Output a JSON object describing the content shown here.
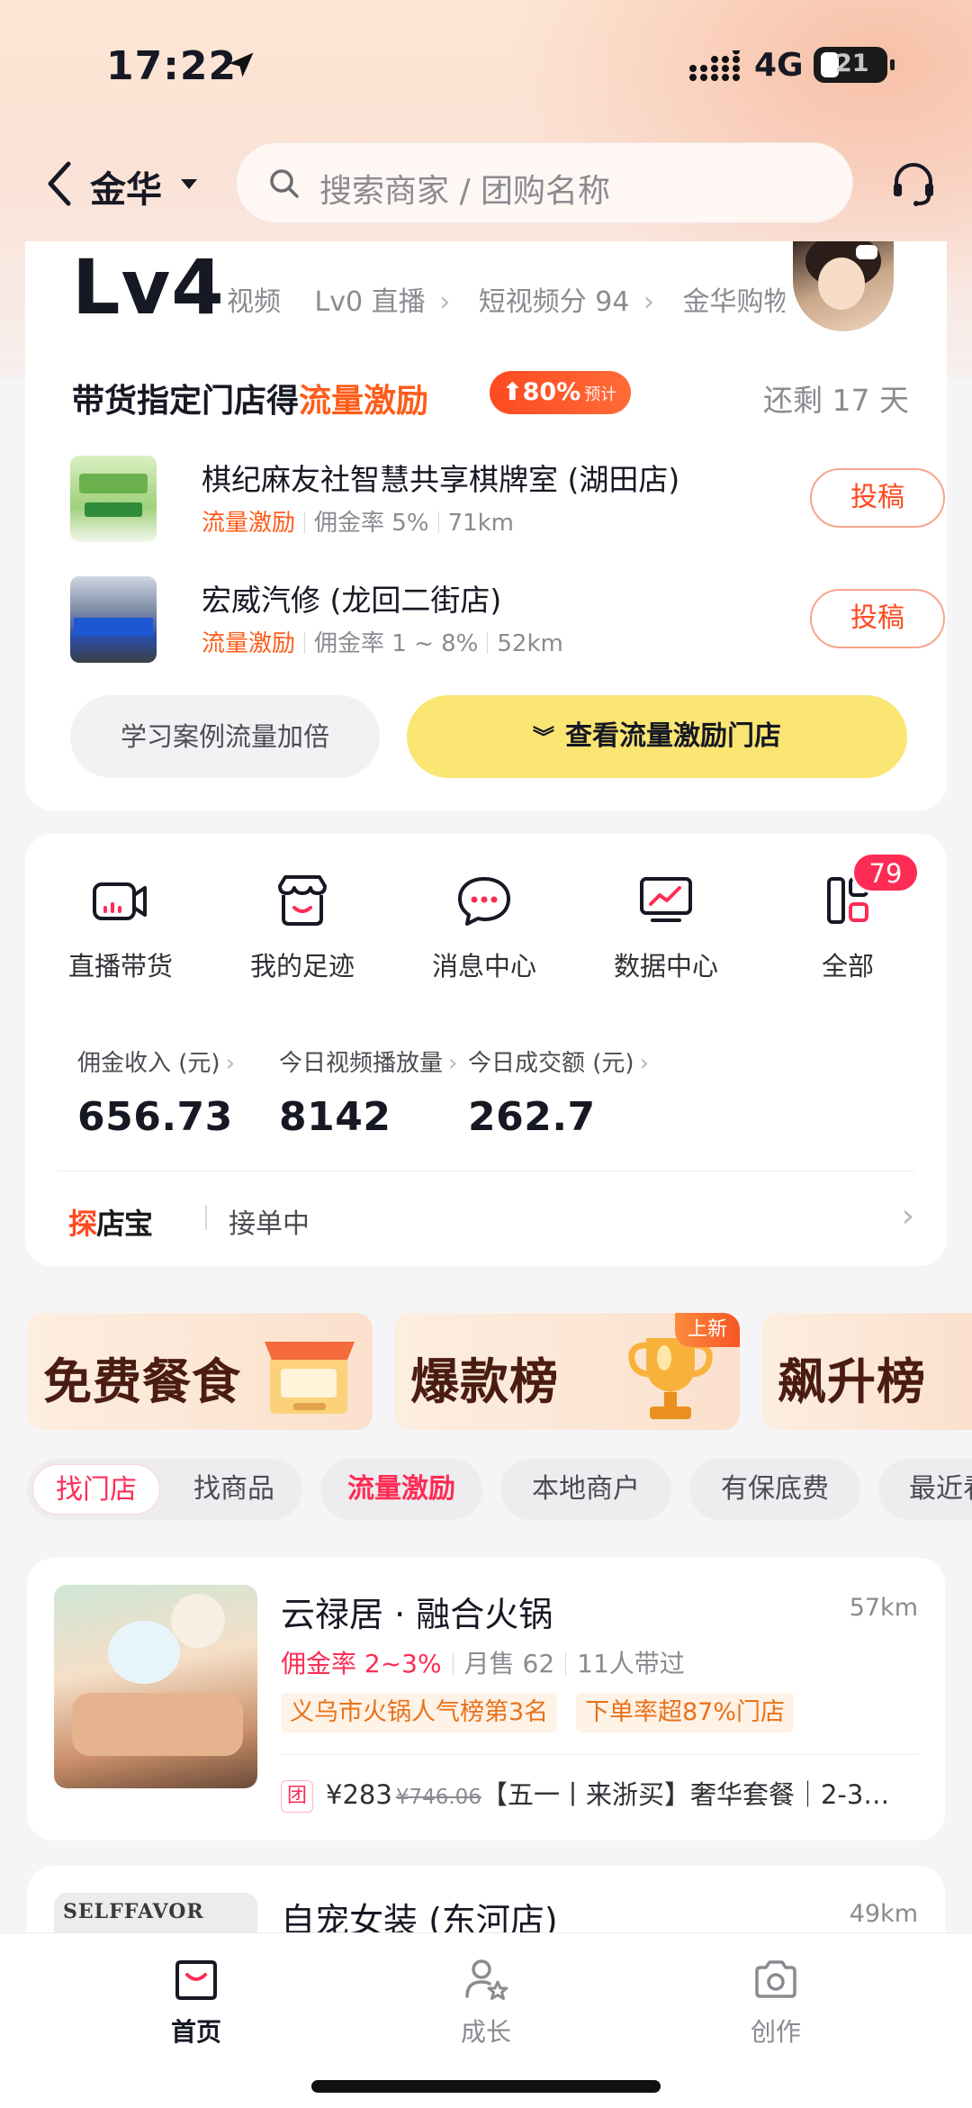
{
  "status_bar": {
    "time": "17:22",
    "network": "4G",
    "battery": "21"
  },
  "header": {
    "city": "金华",
    "search_placeholder": "搜索商家 / 团购名称"
  },
  "level_card": {
    "level": "Lv4",
    "stats": [
      {
        "label": "视频"
      },
      {
        "label": "Lv0 直播"
      },
      {
        "label": "短视频分 94"
      },
      {
        "label": "金华购物"
      }
    ],
    "promo": {
      "title_prefix": "带货指定门店得",
      "title_highlight": "流量激励",
      "badge_value": "80%",
      "badge_note": "预计",
      "remaining": "还剩 17 天"
    },
    "stores": [
      {
        "name": "棋纪麻友社智慧共享棋牌室 (湖田店)",
        "tag": "流量激励",
        "commission": "佣金率 5%",
        "distance": "71km",
        "action": "投稿"
      },
      {
        "name": "宏威汽修 (龙回二街店)",
        "tag": "流量激励",
        "commission": "佣金率 1 ~ 8%",
        "distance": "52km",
        "action": "投稿"
      }
    ],
    "btn_learn": "学习案例流量加倍",
    "btn_view": "查看流量激励门店"
  },
  "tools": {
    "items": [
      {
        "label": "直播带货",
        "icon": "live-camera-icon"
      },
      {
        "label": "我的足迹",
        "icon": "footprint-store-icon"
      },
      {
        "label": "消息中心",
        "icon": "message-bubble-icon"
      },
      {
        "label": "数据中心",
        "icon": "data-chart-icon"
      },
      {
        "label": "全部",
        "icon": "all-grid-icon",
        "badge": "79"
      }
    ],
    "metrics": [
      {
        "label": "佣金收入 (元)",
        "value": "656.73"
      },
      {
        "label": "今日视频播放量",
        "value": "8142"
      },
      {
        "label": "今日成交额 (元)",
        "value": "262.7"
      }
    ],
    "tandianbao": {
      "logo": "探店宝",
      "status": "接单中"
    }
  },
  "rankings": [
    {
      "title": "免费餐食"
    },
    {
      "title": "爆款榜",
      "badge": "上新"
    },
    {
      "title": "飙升榜"
    }
  ],
  "filters": {
    "toggle": [
      "找门店",
      "找商品"
    ],
    "active_toggle": "找门店",
    "chips": [
      "流量激励",
      "本地商户",
      "有保底费",
      "最近看"
    ]
  },
  "listings": [
    {
      "title": "云禄居 · 融合火锅",
      "distance": "57km",
      "commission": "佣金率 2~3%",
      "monthly_sales": "月售 62",
      "people": "11人带过",
      "tags": [
        "义乌市火锅人气榜第3名",
        "下单率超87%门店"
      ],
      "deal_tag": "团",
      "price": "¥283",
      "original_price": "¥746.06",
      "deal_title": "【五一丨来浙买】奢华套餐｜2-3…"
    },
    {
      "title": "自宠女装 (东河店)",
      "distance": "49km",
      "thumb_text": "SELFFAVOR"
    }
  ],
  "bottom_nav": [
    {
      "label": "首页",
      "icon": "home-bag-icon",
      "active": true
    },
    {
      "label": "成长",
      "icon": "growth-user-star-icon",
      "active": false
    },
    {
      "label": "创作",
      "icon": "camera-icon",
      "active": false
    }
  ]
}
